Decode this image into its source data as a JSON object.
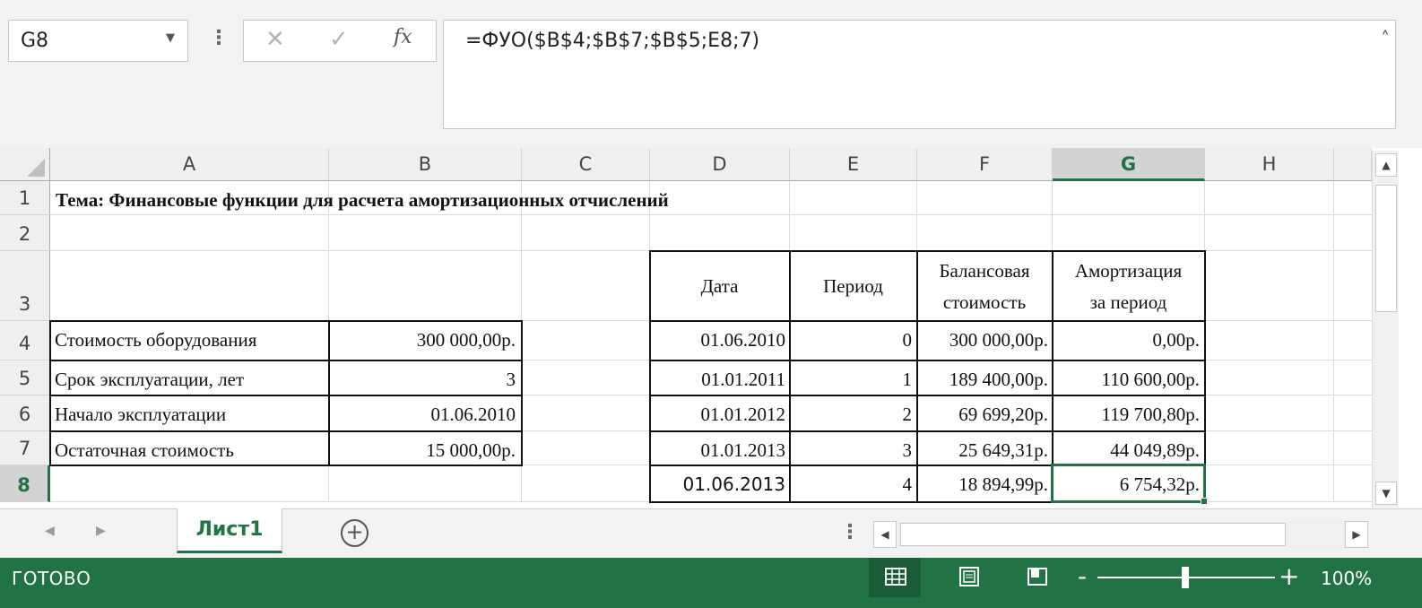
{
  "formula_bar": {
    "name_box": "G8",
    "formula": "=ФУО($B$4;$B$7;$B$5;E8;7)",
    "cancel_icon": "✕",
    "enter_icon": "✓",
    "fx_label": "fx"
  },
  "columns": [
    "A",
    "B",
    "C",
    "D",
    "E",
    "F",
    "G",
    "H"
  ],
  "rows": [
    "1",
    "2",
    "3",
    "4",
    "5",
    "6",
    "7",
    "8"
  ],
  "selected": {
    "column": "G",
    "row": "8"
  },
  "title": "Тема: Финансовые функции для расчета амортизационных отчислений",
  "params": [
    {
      "label": "Стоимость оборудования",
      "value": "300 000,00р."
    },
    {
      "label": "Срок эксплуатации, лет",
      "value": "3"
    },
    {
      "label": "Начало эксплуатации",
      "value": "01.06.2010"
    },
    {
      "label": "Остаточная стоимость",
      "value": "15 000,00р."
    }
  ],
  "schedule": {
    "headers": {
      "date": "Дата",
      "period": "Период",
      "balance_1": "Балансовая",
      "balance_2": "стоимость",
      "amort_1": "Амортизация",
      "amort_2": "за период"
    },
    "rows": [
      {
        "date": "01.06.2010",
        "period": "0",
        "balance": "300 000,00р.",
        "amort": "0,00р."
      },
      {
        "date": "01.01.2011",
        "period": "1",
        "balance": "189 400,00р.",
        "amort": "110 600,00р."
      },
      {
        "date": "01.01.2012",
        "period": "2",
        "balance": "69 699,20р.",
        "amort": "119 700,80р."
      },
      {
        "date": "01.01.2013",
        "period": "3",
        "balance": "25 649,31р.",
        "amort": "44 049,89р."
      },
      {
        "date": "01.06.2013",
        "period": "4",
        "balance": "18 894,99р.",
        "amort": "6 754,32р."
      }
    ]
  },
  "sheet_tab": "Лист1",
  "status": {
    "text": "ГОТОВО",
    "zoom": "100%"
  }
}
